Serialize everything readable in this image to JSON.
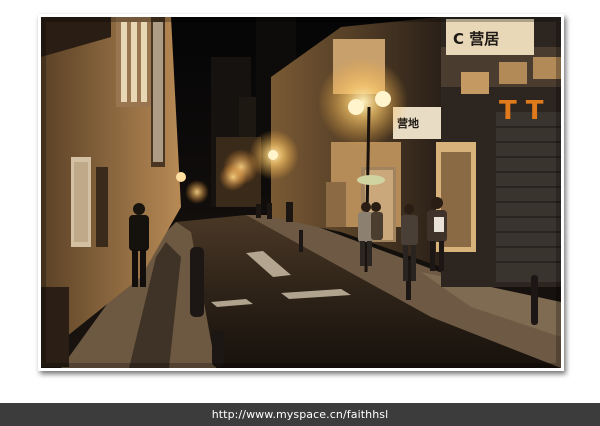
{
  "photo": {
    "sign_top_right": "C 营居",
    "sign_shop": "营地",
    "sign_tt": "T T"
  },
  "footer": {
    "url": "http://www.myspace.cn/faithhsl"
  },
  "colors": {
    "footer_bg": "#3c3c3c",
    "footer_text": "#ffffff",
    "lamp_glow": "#ffcf70",
    "street_dark": "#1a140e"
  }
}
